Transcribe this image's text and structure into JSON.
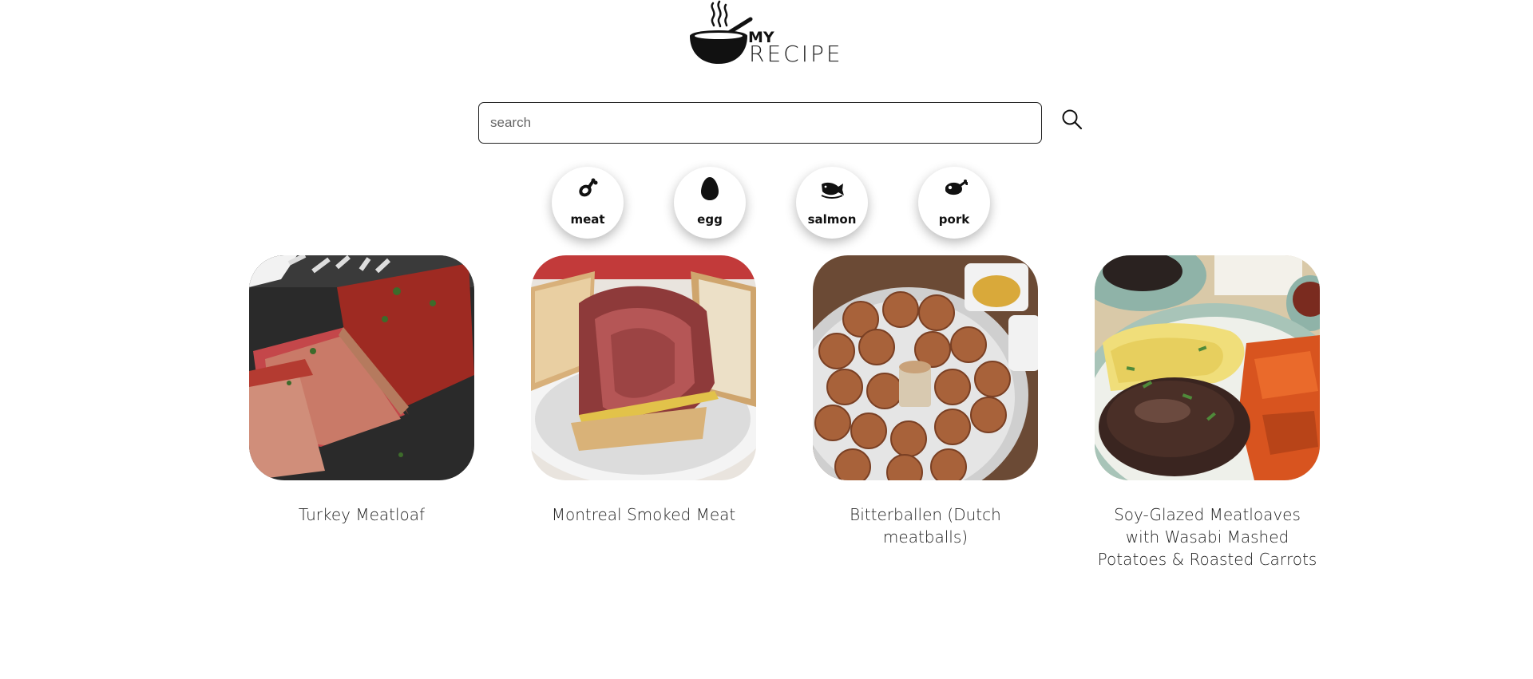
{
  "logo": {
    "my": "MY",
    "recipe": "RECIPE"
  },
  "search": {
    "placeholder": "search",
    "value": ""
  },
  "categories": [
    {
      "label": "meat",
      "icon": "drumstick-icon"
    },
    {
      "label": "egg",
      "icon": "egg-icon"
    },
    {
      "label": "salmon",
      "icon": "fish-icon"
    },
    {
      "label": "pork",
      "icon": "pork-icon"
    }
  ],
  "recipes": [
    {
      "title": "Turkey Meatloaf",
      "image": "turkey-meatloaf-photo"
    },
    {
      "title": "Montreal Smoked Meat",
      "image": "smoked-meat-sandwich-photo"
    },
    {
      "title": "Bitterballen (Dutch meatballs)",
      "image": "bitterballen-photo"
    },
    {
      "title": "Soy-Glazed Meatloaves with Wasabi Mashed Potatoes & Roasted Carrots",
      "image": "soy-glazed-meatloaves-photo"
    }
  ],
  "colors": {
    "text": "#111111",
    "background": "#ffffff",
    "border": "#222222"
  }
}
